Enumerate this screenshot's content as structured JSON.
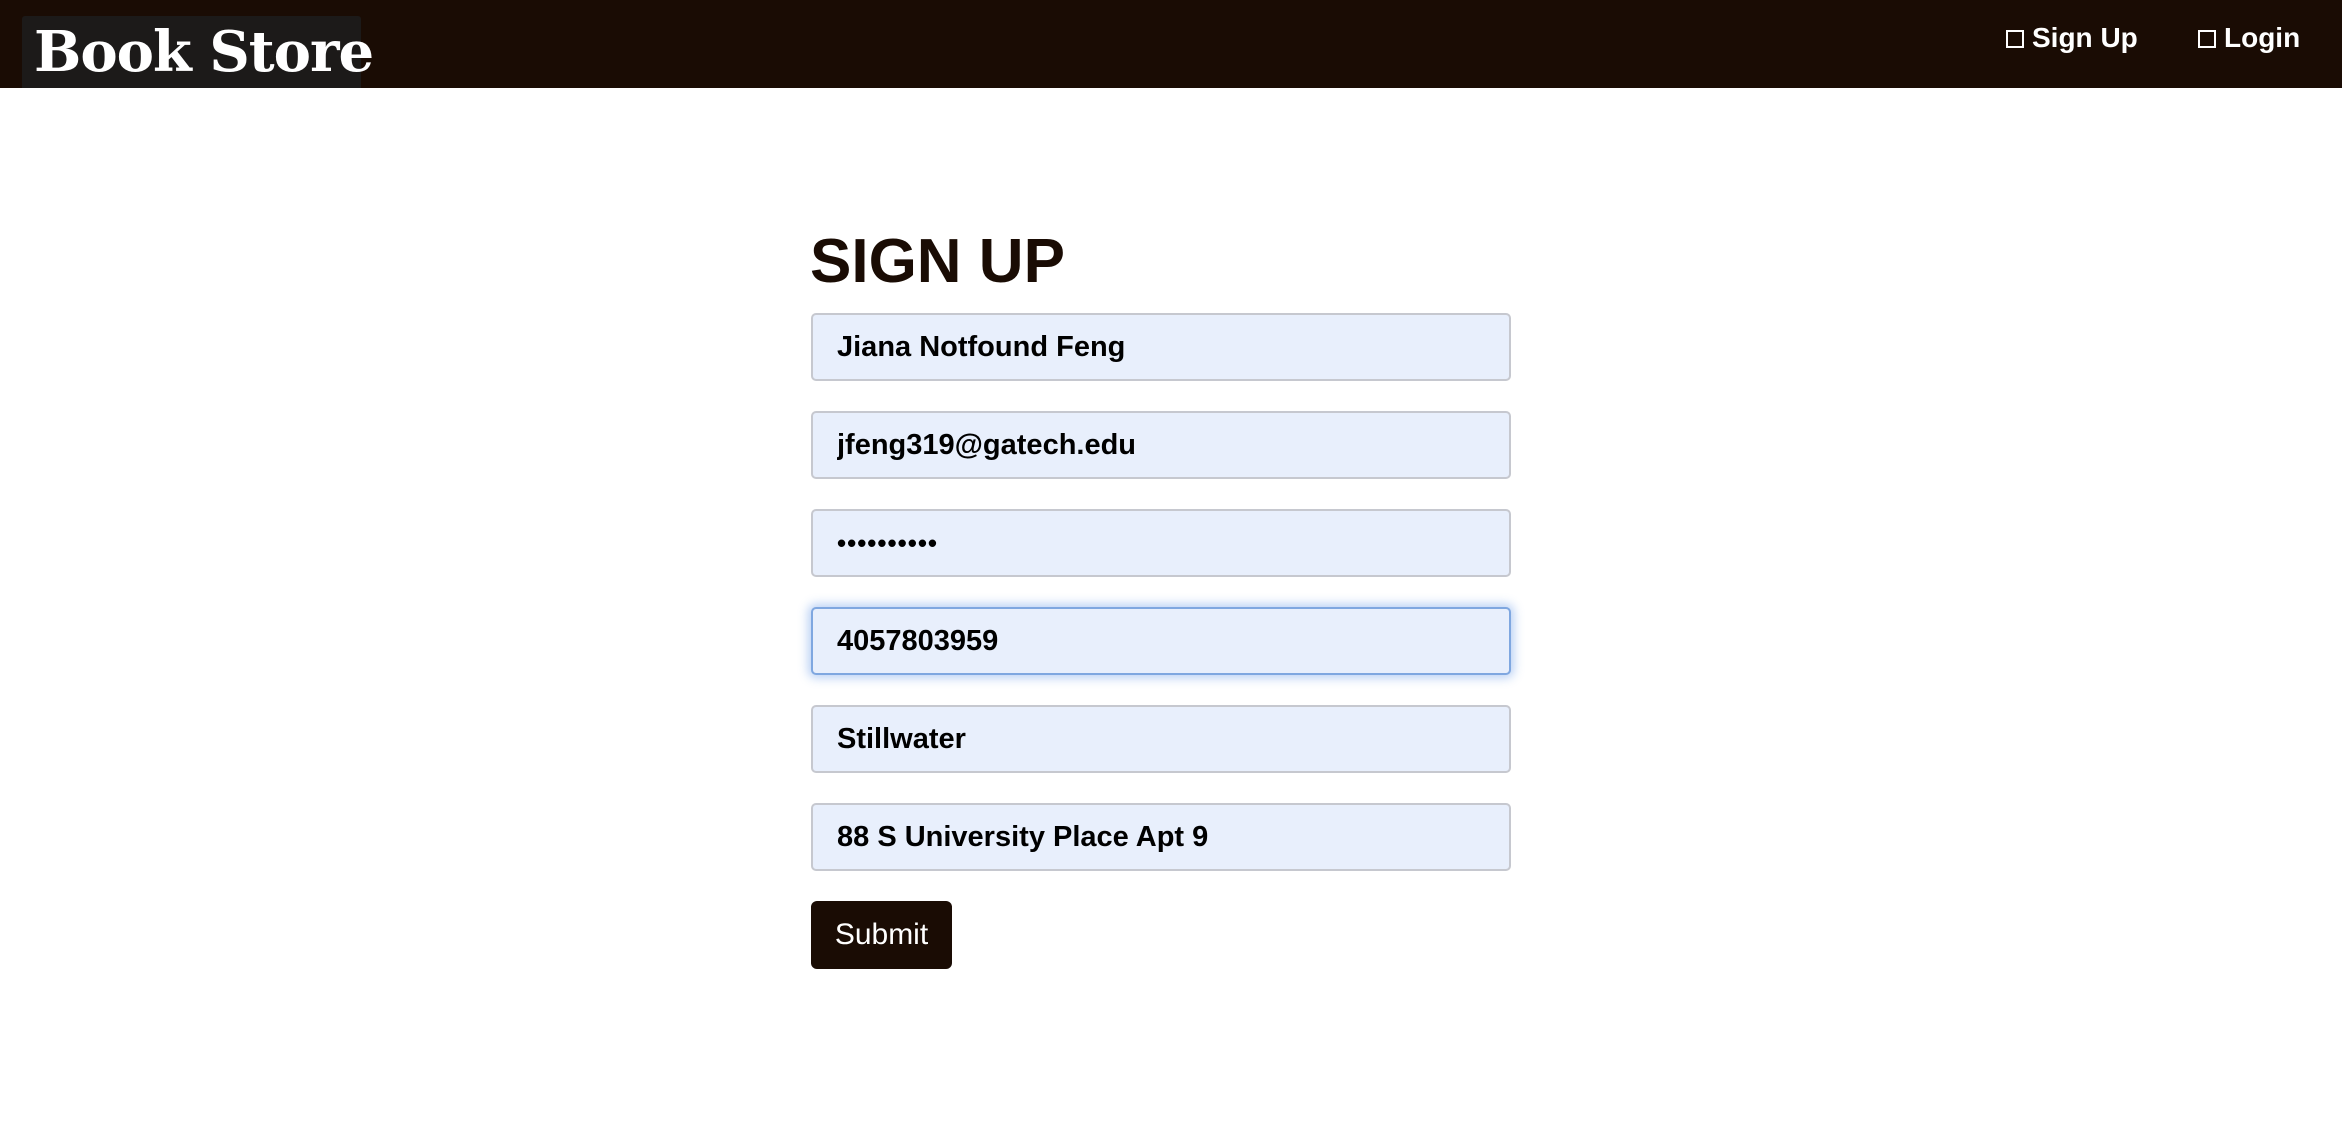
{
  "header": {
    "brand": "Book Store",
    "nav": {
      "signup_label": "Sign Up",
      "login_label": "Login"
    },
    "background_color": "#1a0c04"
  },
  "form": {
    "title": "SIGN UP",
    "fields": {
      "name": "Jiana Notfound Feng",
      "email": "jfeng319@gatech.edu",
      "password": "••••••••••",
      "phone": "4057803959",
      "city": "Stillwater",
      "address": "88 S University Place Apt 9"
    },
    "focused_field": "phone",
    "submit_label": "Submit",
    "field_background": "#e8effc",
    "accent_color": "#1a0c04"
  }
}
